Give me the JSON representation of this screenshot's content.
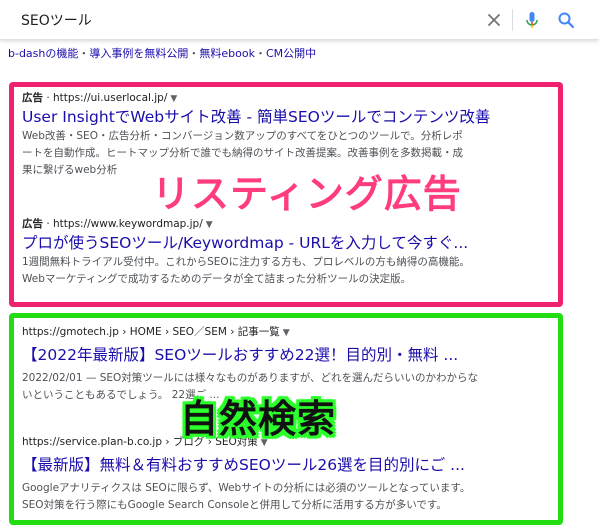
{
  "search": {
    "query": "SEOツール"
  },
  "top_links": [
    "b-dashの機能",
    "導入事例を無料公開",
    "無料ebook",
    "CM公開中"
  ],
  "top_links_sep": "・",
  "ads": [
    {
      "ad_label": "広告",
      "url": "https://ui.userlocal.jp/",
      "title": "User InsightでWebサイト改善 - 簡単SEOツールでコンテンツ改善",
      "snippet_lines": [
        "Web改善・SEO・広告分析・コンバージョン数アップのすべてをひとつのツールで。分析レポ",
        "ートを自動作成。ヒートマップ分析で誰でも納得のサイト改善提案。改善事例を多数掲載・成",
        "果に繋げるweb分析"
      ]
    },
    {
      "ad_label": "広告",
      "url": "https://www.keywordmap.jp/",
      "title": "プロが使うSEOツール/Keywordmap - URLを入力して今すぐ...",
      "snippet_lines": [
        "1週間無料トライアル受付中。これからSEOに注力する方も、プロレベルの方も納得の高機能。",
        "Webマーケティングで成功するためのデータが全て詰まった分析ツールの決定版。"
      ]
    }
  ],
  "organic": [
    {
      "url": "https://gmotech.jp › HOME › SEO／SEM › 記事一覧",
      "title": "【2022年最新版】SEOツールおすすめ22選！目的別・無料 ...",
      "snippet_lines": [
        "2022/02/01 — SEO対策ツールには様々なものがありますが、どれを選んだらいいのかわからな",
        "いということもあるでしょう。                                  22選ご ..."
      ]
    },
    {
      "url": "https://service.plan-b.co.jp › ブログ › SEO対策",
      "title": "【最新版】無料＆有料おすすめSEOツール26選を目的別にご ...",
      "snippet_lines": [
        "Googleアナリティクスは SEOに限らず、Webサイトの分析には必須のツールとなっています。",
        "SEO対策を行う際にもGoogle Search Consoleと併用して分析に活用する方が多いです。"
      ]
    }
  ],
  "overlays": {
    "ads_label": "リスティング広告",
    "organic_label": "自然検索"
  },
  "colors": {
    "ads_border": "#f0216f",
    "organic_border": "#22dd11",
    "link": "#1a0dab"
  },
  "icons": [
    "clear-icon",
    "mic-icon",
    "search-icon",
    "dropdown-arrow-icon"
  ]
}
